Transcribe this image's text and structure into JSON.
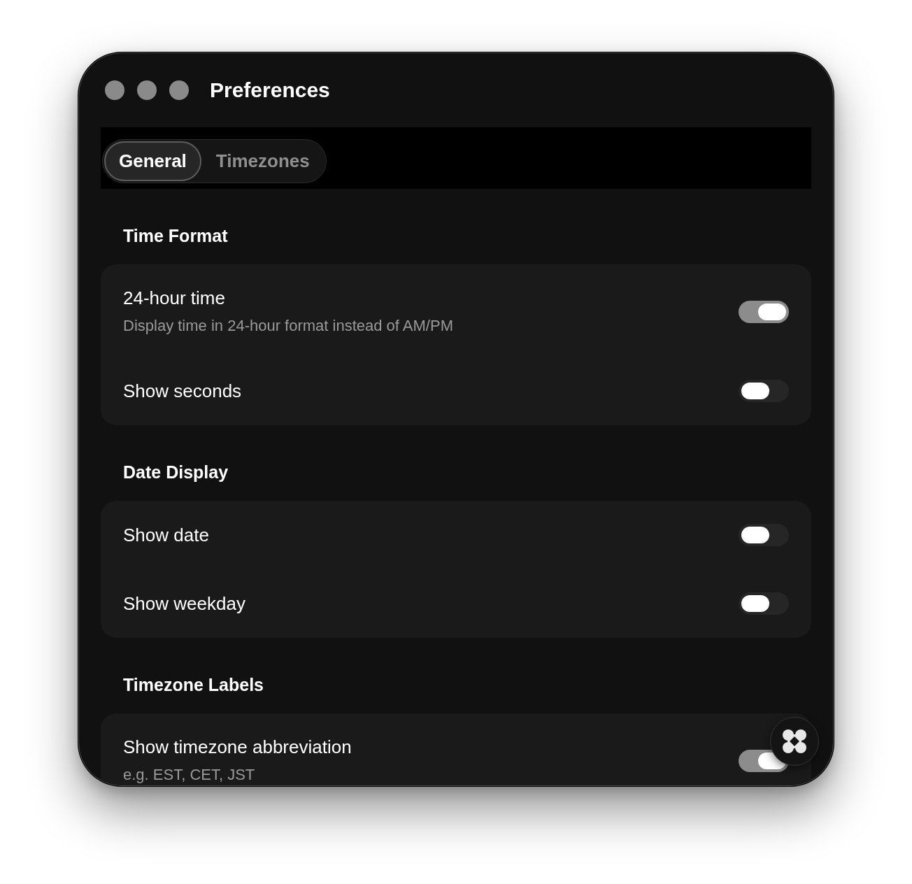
{
  "window": {
    "title": "Preferences"
  },
  "tabs": [
    {
      "label": "General",
      "selected": true
    },
    {
      "label": "Timezones",
      "selected": false
    }
  ],
  "sections": [
    {
      "heading": "Time Format",
      "rows": [
        {
          "label": "24-hour time",
          "description": "Display time in 24-hour format instead of AM/PM",
          "on": true
        },
        {
          "label": "Show seconds",
          "on": false
        }
      ]
    },
    {
      "heading": "Date Display",
      "rows": [
        {
          "label": "Show date",
          "on": false
        },
        {
          "label": "Show weekday",
          "on": false
        }
      ]
    },
    {
      "heading": "Timezone Labels",
      "rows": [
        {
          "label": "Show timezone abbreviation",
          "description": "e.g. EST, CET, JST",
          "on": true
        }
      ]
    }
  ]
}
